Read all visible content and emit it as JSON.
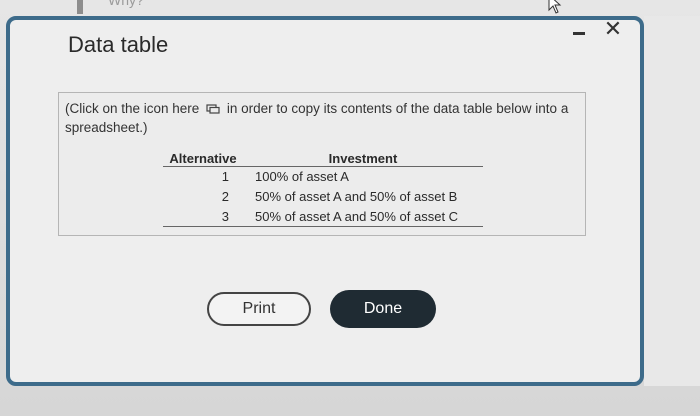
{
  "background": {
    "partial_text": "Why?"
  },
  "dialog": {
    "title": "Data table",
    "controls": {
      "minimize_icon": "minimize-icon",
      "close_icon": "close-icon"
    },
    "info": {
      "text_before_icon": "(Click on the icon here",
      "icon": "copy-icon",
      "text_after_icon": "in order to copy its contents of the data table below into a spreadsheet.)"
    },
    "table": {
      "headers": [
        "Alternative",
        "Investment"
      ],
      "rows": [
        {
          "alternative": "1",
          "investment": "100% of asset A"
        },
        {
          "alternative": "2",
          "investment": "50% of asset A and 50% of asset B"
        },
        {
          "alternative": "3",
          "investment": "50% of asset A and 50% of asset C"
        }
      ]
    },
    "buttons": {
      "print_label": "Print",
      "done_label": "Done"
    }
  },
  "colors": {
    "dialog_border": "#3d6b8a",
    "done_button": "#1f2b33"
  }
}
